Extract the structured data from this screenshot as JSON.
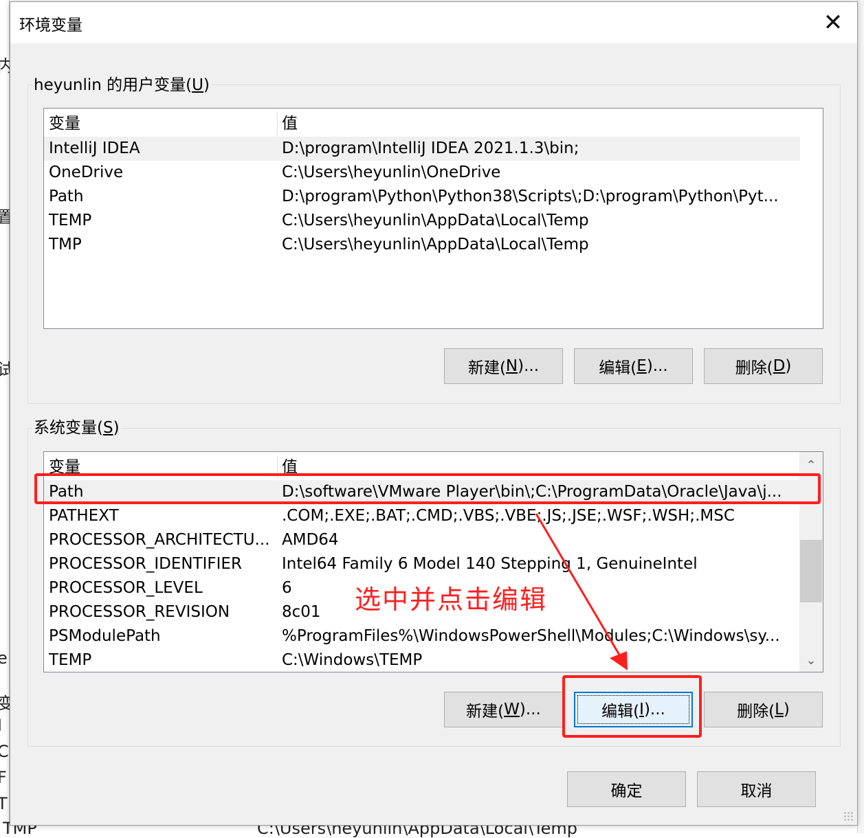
{
  "background": {
    "left_chars": [
      "内",
      "置",
      "试",
      "e",
      "变",
      "I",
      "C",
      "F",
      "T"
    ],
    "bottom_left": "TMP",
    "bottom_right": "C:\\Users\\heyunlin\\AppData\\Local\\Temp"
  },
  "dialog": {
    "title": "环境变量",
    "close_glyph": "✕"
  },
  "user_vars": {
    "label_prefix": "heyunlin 的用户变量(",
    "label_key": "U",
    "label_suffix": ")",
    "columns": [
      "变量",
      "值"
    ],
    "rows": [
      {
        "name": "IntelliJ IDEA",
        "value": "D:\\program\\IntelliJ IDEA 2021.1.3\\bin;"
      },
      {
        "name": "OneDrive",
        "value": "C:\\Users\\heyunlin\\OneDrive"
      },
      {
        "name": "Path",
        "value": "D:\\program\\Python\\Python38\\Scripts\\;D:\\program\\Python\\Pyt..."
      },
      {
        "name": "TEMP",
        "value": "C:\\Users\\heyunlin\\AppData\\Local\\Temp"
      },
      {
        "name": "TMP",
        "value": "C:\\Users\\heyunlin\\AppData\\Local\\Temp"
      }
    ],
    "buttons": {
      "new": {
        "prefix": "新建(",
        "key": "N",
        "suffix": ")..."
      },
      "edit": {
        "prefix": "编辑(",
        "key": "E",
        "suffix": ")..."
      },
      "delete": {
        "prefix": "删除(",
        "key": "D",
        "suffix": ")"
      }
    }
  },
  "system_vars": {
    "label_prefix": "系统变量(",
    "label_key": "S",
    "label_suffix": ")",
    "columns": [
      "变量",
      "值"
    ],
    "rows": [
      {
        "name": "Path",
        "value": "D:\\software\\VMware Player\\bin\\;C:\\ProgramData\\Oracle\\Java\\j..."
      },
      {
        "name": "PATHEXT",
        "value": ".COM;.EXE;.BAT;.CMD;.VBS;.VBE;.JS;.JSE;.WSF;.WSH;.MSC"
      },
      {
        "name": "PROCESSOR_ARCHITECTU...",
        "value": "AMD64"
      },
      {
        "name": "PROCESSOR_IDENTIFIER",
        "value": "Intel64 Family 6 Model 140 Stepping 1, GenuineIntel"
      },
      {
        "name": "PROCESSOR_LEVEL",
        "value": "6"
      },
      {
        "name": "PROCESSOR_REVISION",
        "value": "8c01"
      },
      {
        "name": "PSModulePath",
        "value": "%ProgramFiles%\\WindowsPowerShell\\Modules;C:\\Windows\\sy..."
      },
      {
        "name": "TEMP",
        "value": "C:\\Windows\\TEMP"
      }
    ],
    "scroll_up_glyph": "⌃",
    "scroll_down_glyph": "⌄",
    "buttons": {
      "new": {
        "prefix": "新建(",
        "key": "W",
        "suffix": ")..."
      },
      "edit": {
        "prefix": "编辑(",
        "key": "I",
        "suffix": ")..."
      },
      "delete": {
        "prefix": "删除(",
        "key": "L",
        "suffix": ")"
      }
    }
  },
  "footer": {
    "ok": "确定",
    "cancel": "取消"
  },
  "annotation": {
    "text": "选中并点击编辑",
    "color": "#ff1e1e"
  }
}
